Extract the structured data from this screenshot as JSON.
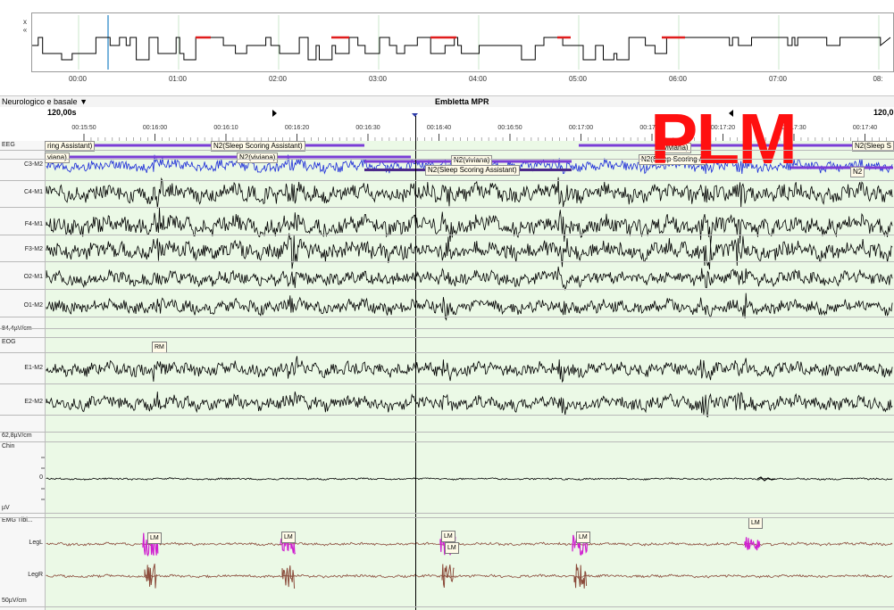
{
  "side_buttons": {
    "close": "x",
    "collapse": "«"
  },
  "hypnogram": {
    "time_labels": [
      "00:00",
      "01:00",
      "02:00",
      "03:00",
      "04:00",
      "05:00",
      "06:00",
      "07:00",
      "08:"
    ],
    "colors": {
      "trace": "#000000",
      "marker": "#78b4dc",
      "highlight": "#e01c1c",
      "grid": "#a8d8a8"
    }
  },
  "montage": {
    "name": "Neurologico e basale",
    "dropdown_arrow": "▼"
  },
  "study_title": "Embletta MPR",
  "ruler": {
    "epoch_left": "120,00s",
    "epoch_right": "120,0",
    "time_labels": [
      "00:15:50",
      "00:16:00",
      "00:16:10",
      "00:16:20",
      "00:16:30",
      "00:16:40",
      "00:16:50",
      "00:17:00",
      "00:17:10",
      "00:17:20",
      "00:17:30",
      "00:17:40"
    ],
    "nav_icons": [
      "play-right-icon",
      "nav-down-icon",
      "play-left-icon"
    ]
  },
  "scoring": {
    "n2_assistant_label": "N2(Sleep Scoring Assistant)",
    "n2_assistant_trunc_left": "ring Assistant)",
    "n2_assistant_trunc_right": "N2(Sleep S",
    "n2_viviana_label": "N2(viviana)",
    "n2_viviana_trunc_left": "viana)",
    "n2_viviana_trunc_right": "viviana)",
    "n2_assistant_under_banner": "N2(Sleep Scoring A",
    "n2_short": "N2",
    "colors": {
      "bar": "#7a3ed6",
      "bar_dark": "#4b2a8a"
    }
  },
  "channels": {
    "eeg_group": "EEG",
    "eeg": [
      "C3-M2",
      "C4-M1",
      "F4-M1",
      "F3-M2",
      "O2-M1",
      "O1-M2"
    ],
    "eeg_scale": "84,4µV/cm",
    "eog_group": "EOG",
    "eog": [
      "E1-M2",
      "E2-M2"
    ],
    "eog_scale": "62,8µV/cm",
    "chin_group": "Chin",
    "chin_zero": "0",
    "chin_unit": "µV",
    "emg_group": "EMG Tibi...",
    "emg": [
      "LegL",
      "LegR"
    ],
    "emg_scale": "50µV/cm"
  },
  "events": {
    "rm_label": "RM",
    "lm_label": "LM",
    "lm_short": "LM"
  },
  "trace_colors": {
    "eeg": "#000000",
    "c3": "#1a2ad8",
    "emg": "#8a4a3a",
    "lm": "#d020d0"
  },
  "banner": {
    "text": "PLM",
    "color": "#ff1010"
  }
}
